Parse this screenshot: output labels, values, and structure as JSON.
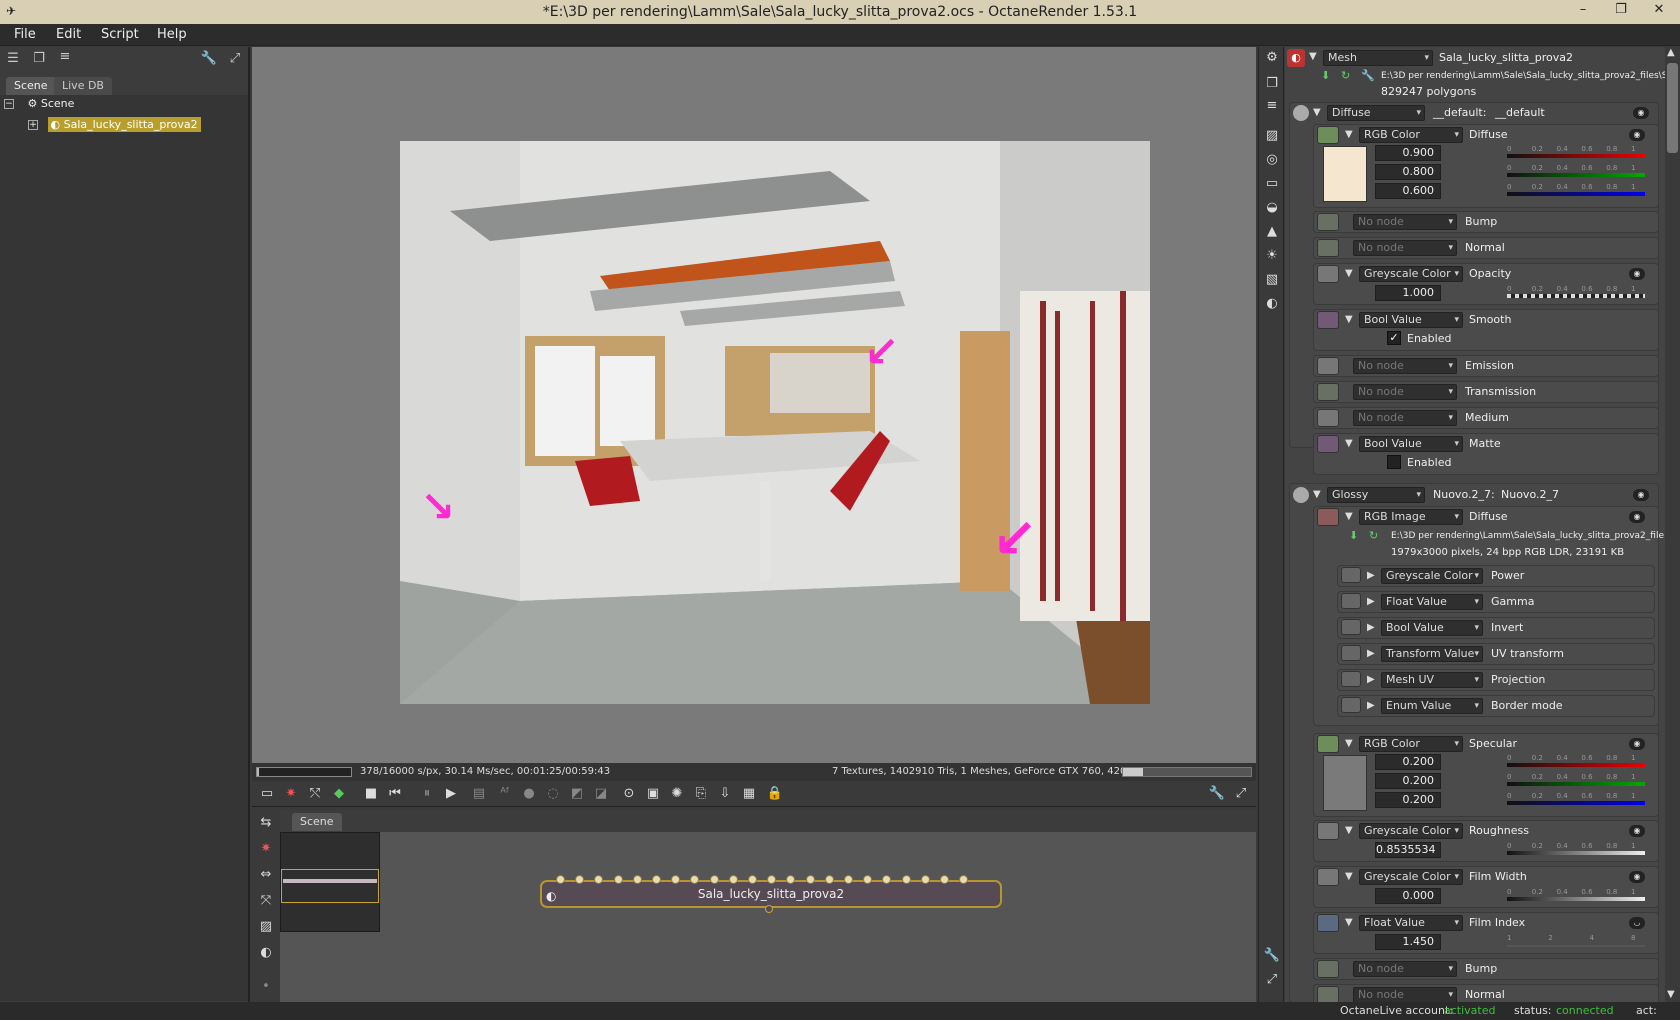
{
  "window": {
    "title": "*E:\\3D per rendering\\Lamm\\Sale\\Sala_lucky_slitta_prova2.ocs - OctaneRender 1.53.1"
  },
  "menu": {
    "file": "File",
    "edit": "Edit",
    "script": "Script",
    "help": "Help"
  },
  "left": {
    "tabs": {
      "scene": "Scene",
      "livedb": "Live DB"
    },
    "tree": {
      "root": "Scene",
      "child": "Sala_lucky_slitta_prova2"
    }
  },
  "viewport": {
    "status_left": "378/16000 s/px, 30.14 Ms/sec, 00:01:25/00:59:43",
    "status_right": "7 Textures, 1402910 Tris, 1 Meshes, GeForce GTX 760, 420.8/1858/2048 MB",
    "progress": 0.024
  },
  "nodegraph": {
    "tab": "Scene",
    "node_label": "Sala_lucky_slitta_prova2"
  },
  "inspector": {
    "mesh": {
      "type": "Mesh",
      "name": "Sala_lucky_slitta_prova2",
      "path": "E:\\3D per rendering\\Lamm\\Sale\\Sala_lucky_slitta_prova2_files\\Sala_lucky_s...",
      "polygons": "829247 polygons"
    },
    "diffuse_mat": {
      "type": "Diffuse",
      "name": "__default:",
      "name2": "__default",
      "diffuse": {
        "type": "RGB Color",
        "label": "Diffuse",
        "r": "0.900",
        "g": "0.800",
        "b": "0.600",
        "swatch": "#f5e6cf"
      },
      "bump": {
        "type": "No node",
        "label": "Bump"
      },
      "normal": {
        "type": "No node",
        "label": "Normal"
      },
      "opacity": {
        "type": "Greyscale Color",
        "label": "Opacity",
        "value": "1.000"
      },
      "smooth": {
        "type": "Bool Value",
        "label": "Smooth",
        "check": "Enabled",
        "checked": true
      },
      "emission": {
        "type": "No node",
        "label": "Emission"
      },
      "transmission": {
        "type": "No node",
        "label": "Transmission"
      },
      "medium": {
        "type": "No node",
        "label": "Medium"
      },
      "matte": {
        "type": "Bool Value",
        "label": "Matte",
        "check": "Enabled",
        "checked": false
      }
    },
    "glossy_mat": {
      "type": "Glossy",
      "name": "Nuovo.2_7:",
      "name2": "Nuovo.2_7",
      "diffuse": {
        "type": "RGB Image",
        "label": "Diffuse",
        "path": "E:\\3D per rendering\\Lamm\\Sale\\Sala_lucky_slitta_prova2_file...",
        "info": "1979x3000 pixels, 24 bpp RGB LDR, 23191 KB",
        "subs": [
          {
            "type": "Greyscale Color",
            "label": "Power"
          },
          {
            "type": "Float Value",
            "label": "Gamma"
          },
          {
            "type": "Bool Value",
            "label": "Invert"
          },
          {
            "type": "Transform Value",
            "label": "UV transform"
          },
          {
            "type": "Mesh UV",
            "label": "Projection"
          },
          {
            "type": "Enum Value",
            "label": "Border mode"
          }
        ]
      },
      "specular": {
        "type": "RGB Color",
        "label": "Specular",
        "r": "0.200",
        "g": "0.200",
        "b": "0.200",
        "swatch": "#7a7a7a"
      },
      "roughness": {
        "type": "Greyscale Color",
        "label": "Roughness",
        "value": "0.8535534"
      },
      "filmwidth": {
        "type": "Greyscale Color",
        "label": "Film Width",
        "value": "0.000"
      },
      "filmindex": {
        "type": "Float Value",
        "label": "Film Index",
        "value": "1.450"
      },
      "bump": {
        "type": "No node",
        "label": "Bump"
      },
      "normal": {
        "type": "No node",
        "label": "Normal"
      }
    },
    "scale_ticks": [
      "0",
      "0.2",
      "0.4",
      "0.6",
      "0.8",
      "1"
    ],
    "index_ticks": [
      "1",
      "2",
      "4",
      "8"
    ]
  },
  "status": {
    "account_label": "OctaneLive account:",
    "account_value": "activated",
    "status_label": "status:",
    "status_value": "connected",
    "act_label": "act:"
  },
  "colors": {
    "accent": "#3fbf3f",
    "node_border": "#b7962e",
    "annotation": "#ff2ad2"
  }
}
